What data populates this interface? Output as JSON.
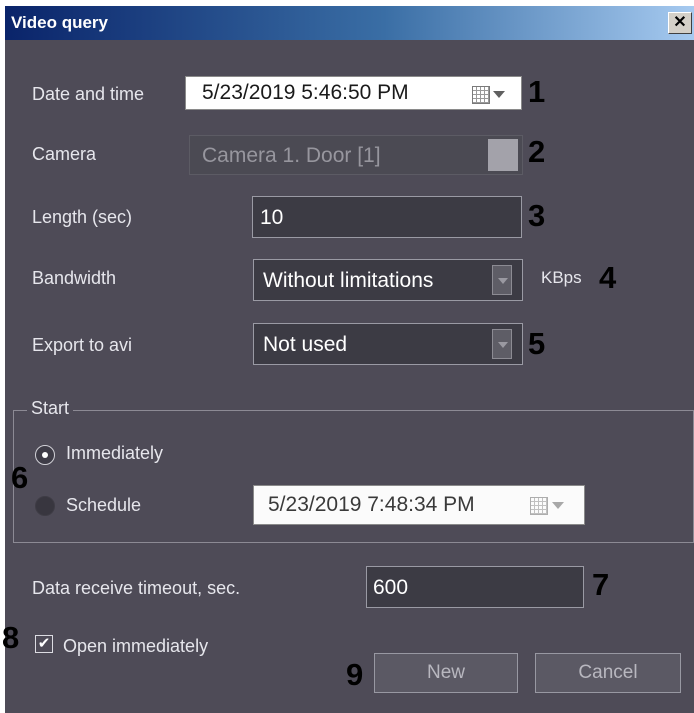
{
  "window": {
    "title": "Video query",
    "close_glyph": "✕"
  },
  "fields": {
    "date_time": {
      "label": "Date and time",
      "value": "5/23/2019   5:46:50 PM"
    },
    "camera": {
      "label": "Camera",
      "value": "Camera 1. Door [1]"
    },
    "length": {
      "label": "Length (sec)",
      "value": "10"
    },
    "bandwidth": {
      "label": "Bandwidth",
      "value": "Without limitations",
      "unit": "KBps"
    },
    "export_avi": {
      "label": "Export to avi",
      "value": "Not used"
    }
  },
  "start_group": {
    "label": "Start",
    "immediately": {
      "label": "Immediately",
      "selected": true
    },
    "schedule": {
      "label": "Schedule",
      "selected": false,
      "value": "5/23/2019   7:48:34 PM"
    }
  },
  "timeout": {
    "label": "Data receive timeout, sec.",
    "value": "600"
  },
  "open_immediately": {
    "label": "Open immediately",
    "checked": true
  },
  "buttons": {
    "new": "New",
    "cancel": "Cancel"
  },
  "callouts": [
    "1",
    "2",
    "3",
    "4",
    "5",
    "6",
    "7",
    "8",
    "9"
  ],
  "icons": {
    "calendar": "calendar-icon",
    "dropdown": "chevron-down-icon",
    "close": "close-icon"
  },
  "colors": {
    "dialog_bg": "#4e4b57",
    "titlebar": "#0a246a",
    "field_bg": "#3c3b44"
  }
}
